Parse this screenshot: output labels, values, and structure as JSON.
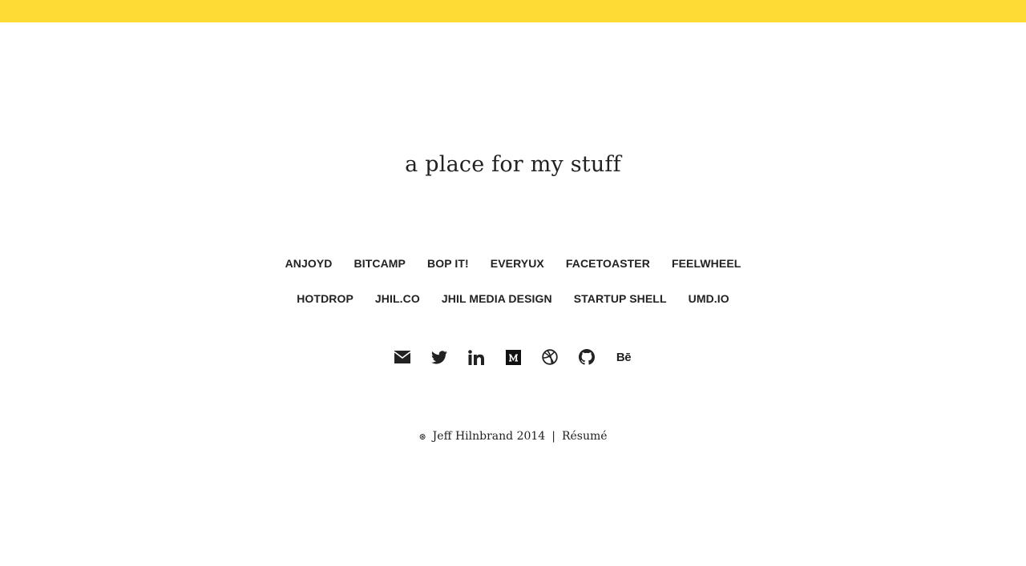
{
  "colors": {
    "accent_bar": "#FFDC35",
    "text": "#222222",
    "background": "#ffffff"
  },
  "header": {
    "tagline": "a place for my stuff"
  },
  "nav": {
    "row1": [
      "ANJOYD",
      "BITCAMP",
      "BOP IT!",
      "EVERYUX",
      "FACETOASTER",
      "FEELWHEEL"
    ],
    "row2": [
      "HOTDROP",
      "JHIL.CO",
      "JHIL MEDIA DESIGN",
      "STARTUP SHELL",
      "UMD.IO"
    ]
  },
  "social": {
    "icons": [
      "email-icon",
      "twitter-icon",
      "linkedin-icon",
      "medium-icon",
      "dribbble-icon",
      "github-icon",
      "behance-icon"
    ],
    "behance_label": "Bē"
  },
  "footer": {
    "mark": "⊛",
    "copyright": "Jeff Hilnbrand 2014",
    "separator": "|",
    "resume_label": "Résumé"
  }
}
